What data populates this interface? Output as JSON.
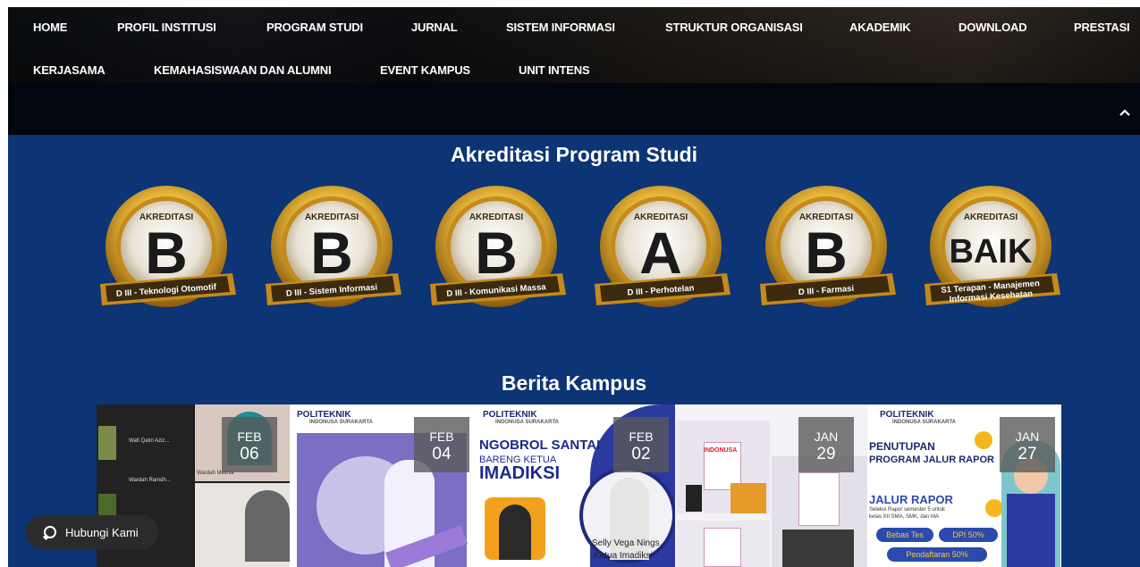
{
  "nav": {
    "items": [
      {
        "label": "HOME"
      },
      {
        "label": "PROFIL INSTITUSI"
      },
      {
        "label": "PROGRAM STUDI"
      },
      {
        "label": "JURNAL"
      },
      {
        "label": "SISTEM INFORMASI"
      },
      {
        "label": "STRUKTUR ORGANISASI"
      },
      {
        "label": "AKADEMIK"
      },
      {
        "label": "DOWNLOAD"
      },
      {
        "label": "PRESTASI"
      },
      {
        "label": "KERJASAMA"
      },
      {
        "label": "KEMAHASISWAAN DAN ALUMNI"
      },
      {
        "label": "EVENT KAMPUS"
      },
      {
        "label": "UNIT INTENS"
      }
    ],
    "scroll_up_icon": "chevron-up-icon"
  },
  "accreditation": {
    "title": "Akreditasi Program Studi",
    "badges": [
      {
        "header": "AKREDITASI",
        "grade": "B",
        "program": "D III - Teknologi Otomotif"
      },
      {
        "header": "AKREDITASI",
        "grade": "B",
        "program": "D III - Sistem Informasi"
      },
      {
        "header": "AKREDITASI",
        "grade": "B",
        "program": "D III - Komunikasi Massa"
      },
      {
        "header": "AKREDITASI",
        "grade": "A",
        "program": "D III - Perhotelan"
      },
      {
        "header": "AKREDITASI",
        "grade": "B",
        "program": "D III - Farmasi"
      },
      {
        "header": "AKREDITASI",
        "grade": "BAIK",
        "program": "S1 Terapan - Manajemen Informasi Kesehatan"
      }
    ]
  },
  "news": {
    "title": "Berita Kampus",
    "cards": [
      {
        "month": "FEB",
        "day": "06",
        "texts": [
          "Wafi Qatin Aziz...",
          "Wardah Ramdh...",
          "Wardah Melinia"
        ]
      },
      {
        "month": "FEB",
        "day": "04",
        "texts": [
          "POLITEKNIK",
          "INDONUSA SURAKARTA"
        ]
      },
      {
        "month": "FEB",
        "day": "02",
        "texts": [
          "POLITEKNIK",
          "INDONUSA SURAKARTA",
          "NGOBROL SANTAI",
          "BARENG KETUA",
          "IMADIKSI",
          "Selly Vega Nings",
          "Ketua Imadiksi"
        ]
      },
      {
        "month": "JAN",
        "day": "29",
        "texts": [
          "INDONUSA"
        ]
      },
      {
        "month": "JAN",
        "day": "27",
        "texts": [
          "POLITEKNIK",
          "INDONUSA SURAKARTA",
          "PENUTUPAN",
          "PROGRAM JALUR RAPOR",
          "JALUR RAPOR",
          "Seleksi Rapor semester 5 untuk",
          "kelas XII SMA, SMK, dan MA",
          "Bebas Tes",
          "DPI 50%",
          "Pendaftaran 50%"
        ]
      }
    ]
  },
  "contact": {
    "label": "Hubungi Kami",
    "icon": "whatsapp-icon"
  },
  "colors": {
    "page_bg": "#0d3474",
    "header_bg": "#02060f",
    "gold": "#d9a420"
  }
}
